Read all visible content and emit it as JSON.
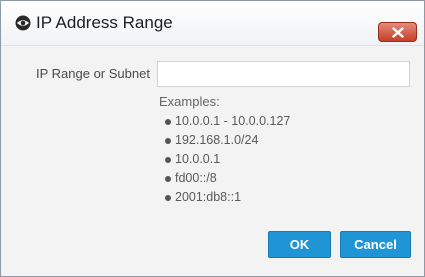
{
  "dialog": {
    "title": "IP Address Range",
    "icon": "eye-icon",
    "close_icon": "close-icon"
  },
  "form": {
    "label": "IP Range or Subnet",
    "value": "",
    "placeholder": ""
  },
  "examples": {
    "heading": "Examples:",
    "items": [
      "10.0.0.1 - 10.0.0.127",
      "192.168.1.0/24",
      "10.0.0.1",
      "fd00::/8",
      "2001:db8::1"
    ]
  },
  "buttons": {
    "ok": "OK",
    "cancel": "Cancel"
  },
  "colors": {
    "primary_button": "#1f95d6",
    "close_button": "#c53f28"
  }
}
